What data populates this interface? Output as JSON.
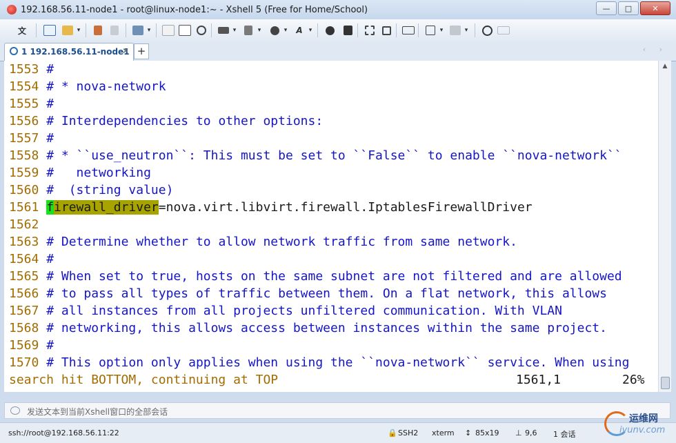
{
  "window": {
    "title": "192.168.56.11-node1 - root@linux-node1:~ - Xshell 5 (Free for Home/School)",
    "controls": {
      "minimize": "—",
      "maximize": "□",
      "close": "✕"
    }
  },
  "toolbar": {
    "language_label": "文",
    "dropdown_glyph": "▾"
  },
  "tabs": [
    {
      "label": "1 192.168.56.11-node1",
      "close": "✕"
    }
  ],
  "tab_add": "+",
  "tab_nav": "‹ ›",
  "terminal": {
    "lines": [
      {
        "num": "1553",
        "text": "#"
      },
      {
        "num": "1554",
        "text": "# * nova-network"
      },
      {
        "num": "1555",
        "text": "#"
      },
      {
        "num": "1556",
        "text": "# Interdependencies to other options:"
      },
      {
        "num": "1557",
        "text": "#"
      },
      {
        "num": "1558",
        "text": "# * ``use_neutron``: This must be set to ``False`` to enable ``nova-network``"
      },
      {
        "num": "1559",
        "text": "#   networking"
      },
      {
        "num": "1560",
        "text": "#  (string value)"
      },
      {
        "num": "1561",
        "cursor_char": "f",
        "highlight": "irewall_driver",
        "rest": "=nova.virt.libvirt.firewall.IptablesFirewallDriver"
      },
      {
        "num": "1562",
        "text": ""
      },
      {
        "num": "1563",
        "text": "# Determine whether to allow network traffic from same network."
      },
      {
        "num": "1564",
        "text": "#"
      },
      {
        "num": "1565",
        "text": "# When set to true, hosts on the same subnet are not filtered and are allowed"
      },
      {
        "num": "1566",
        "text": "# to pass all types of traffic between them. On a flat network, this allows"
      },
      {
        "num": "1567",
        "text": "# all instances from all projects unfiltered communication. With VLAN"
      },
      {
        "num": "1568",
        "text": "# networking, this allows access between instances within the same project."
      },
      {
        "num": "1569",
        "text": "#"
      },
      {
        "num": "1570",
        "text": "# This option only applies when using the ``nova-network`` service. When using"
      }
    ],
    "status_message": "search hit BOTTOM, continuing at TOP",
    "cursor_position": "1561,1",
    "scroll_percent": "26%"
  },
  "send_bar": {
    "placeholder": "发送文本到当前Xshell窗口的全部会话"
  },
  "statusbar": {
    "connection": "ssh://root@192.168.56.11:22",
    "protocol": "SSH2",
    "terminal_type": "xterm",
    "size": "85x19",
    "cursor": "9,6",
    "sessions": "1 会话"
  },
  "watermark": {
    "line1": "运维网",
    "line2": "iyunv.com"
  }
}
